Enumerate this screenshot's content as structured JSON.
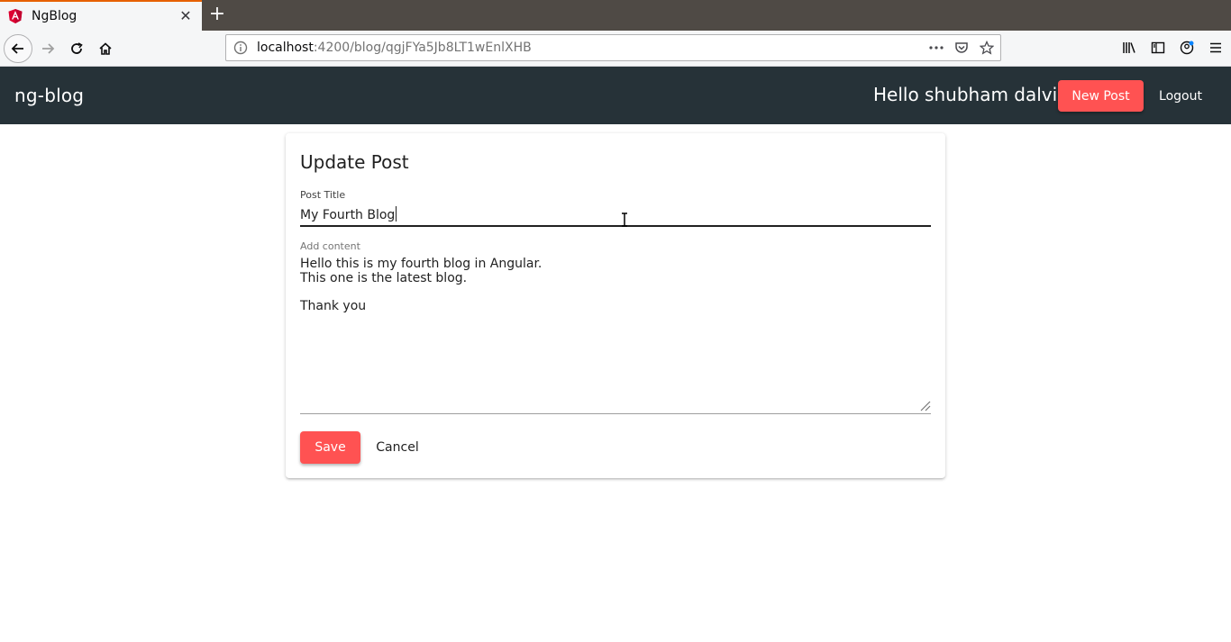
{
  "browser": {
    "tab_title": "NgBlog",
    "url_host": "localhost",
    "url_path": ":4200/blog/qgjFYa5Jb8LT1wEnlXHB",
    "icons": [
      "angular-favicon",
      "close-icon",
      "plus-icon",
      "back-arrow-icon",
      "forward-arrow-icon",
      "reload-icon",
      "home-icon",
      "info-icon",
      "more-dots-icon",
      "pocket-icon",
      "star-icon",
      "library-icon",
      "sidebar-icon",
      "account-icon",
      "hamburger-menu-icon"
    ]
  },
  "header": {
    "brand": "ng-blog",
    "greeting": "Hello shubham dalvi",
    "new_post_label": "New Post",
    "logout_label": "Logout",
    "background_color": "#263238",
    "accent_color": "#ff5252"
  },
  "form": {
    "heading": "Update Post",
    "title_label": "Post Title",
    "title_value": "My Fourth Blog",
    "content_label": "Add content",
    "content_lines": [
      "Hello this is my fourth blog in Angular.",
      "This one is the latest blog.",
      "",
      "Thank you"
    ],
    "save_label": "Save",
    "cancel_label": "Cancel"
  }
}
